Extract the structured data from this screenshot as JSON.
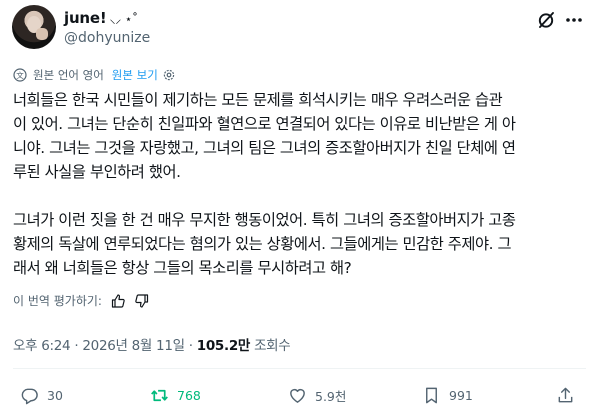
{
  "author": {
    "display_name": "june!",
    "name_decoration": "⸜⸝ ⋆˚",
    "handle": "@dohyunize"
  },
  "icons": {
    "grok": "slashed-circle-icon",
    "more": "more-dots-icon",
    "translate": "translate-icon",
    "settings": "gear-icon",
    "thumbs_up": "thumbs-up-icon",
    "thumbs_down": "thumbs-down-icon",
    "reply": "reply-icon",
    "retweet": "retweet-icon",
    "like": "heart-icon",
    "bookmark": "bookmark-icon",
    "share": "share-icon"
  },
  "translation": {
    "source_language": "원본 언어 영어",
    "show_original": "원본 보기"
  },
  "tweet": {
    "lines": [
      "너희들은 한국 시민들이 제기하는 모든 문제를 희석시키는 매우 우려스러운 습관",
      "이 있어. 그녀는 단순히 친일파와 혈연으로 연결되어 있다는 이유로 비난받은 게 아",
      "니야. 그녀는 그것을 자랑했고, 그녀의 팀은 그녀의 증조할아버지가 친일 단체에 연",
      "루된 사실을 부인하려 했어.",
      "그녀가 이런 짓을 한 건 매우 무지한 행동이었어. 특히 그녀의 증조할아버지가 고종",
      "황제의 독살에 연루되었다는 혐의가 있는 상황에서. 그들에게는 민감한 주제야. 그",
      "래서 왜 너희들은 항상 그들의 목소리를 무시하려고 해?"
    ]
  },
  "rate_translation": "이 번역 평가하기:",
  "meta": {
    "time": "오후 6:24",
    "separator": "·",
    "date": "2026년 8월 11일",
    "views": "105.2만",
    "views_label": "조회수"
  },
  "actions": {
    "replies": "30",
    "retweets": "768",
    "likes": "5.9천",
    "bookmarks": "991"
  },
  "colors": {
    "accent": "#1d9bf0",
    "retweet_active": "#00ba7c",
    "secondary_text": "#536471",
    "primary_text": "#0f1419"
  }
}
